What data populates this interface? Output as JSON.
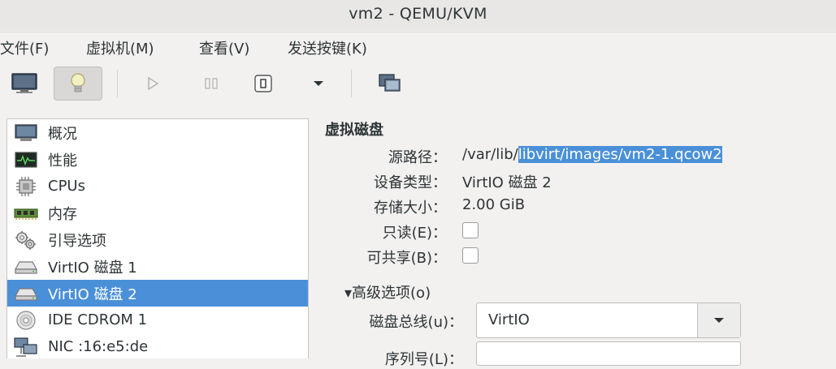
{
  "window": {
    "title": "vm2 - QEMU/KVM"
  },
  "menu": [
    "文件(F)",
    "虚拟机(M)",
    "查看(V)",
    "发送按键(K)"
  ],
  "toolbar": {
    "buttons": [
      "monitor-icon",
      "lightbulb-icon",
      "play-icon",
      "pause-icon",
      "power-icon",
      "chevron-down-icon",
      "screens-icon"
    ]
  },
  "sidebar": {
    "items": [
      {
        "label": "概况",
        "icon": "overview-icon"
      },
      {
        "label": "性能",
        "icon": "performance-icon"
      },
      {
        "label": "CPUs",
        "icon": "cpu-icon"
      },
      {
        "label": "内存",
        "icon": "memory-icon"
      },
      {
        "label": "引导选项",
        "icon": "boot-options-icon"
      },
      {
        "label": "VirtIO 磁盘 1",
        "icon": "disk-icon"
      },
      {
        "label": "VirtIO 磁盘 2",
        "icon": "disk-icon",
        "selected": true
      },
      {
        "label": "IDE CDROM 1",
        "icon": "cdrom-icon"
      },
      {
        "label": "NIC :16:e5:de",
        "icon": "network-icon"
      }
    ]
  },
  "panel": {
    "title": "虚拟磁盘",
    "source_label": "源路径：",
    "source_prefix": "/var/lib/",
    "source_selected": "libvirt/images/vm2-1.qcow2",
    "device_type_label": "设备类型：",
    "device_type_value": "VirtIO 磁盘 2",
    "storage_size_label": "存储大小：",
    "storage_size_value": "2.00 GiB",
    "readonly_label": "只读(E)：",
    "shareable_label": "可共享(B)：",
    "advanced_label": "▾高级选项(o)",
    "disk_bus_label": "磁盘总线(u)：",
    "disk_bus_value": "VirtIO",
    "serial_label": "序列号(L)："
  },
  "colors": {
    "selection": "#4a90d9",
    "background": "#f2f1f0"
  }
}
